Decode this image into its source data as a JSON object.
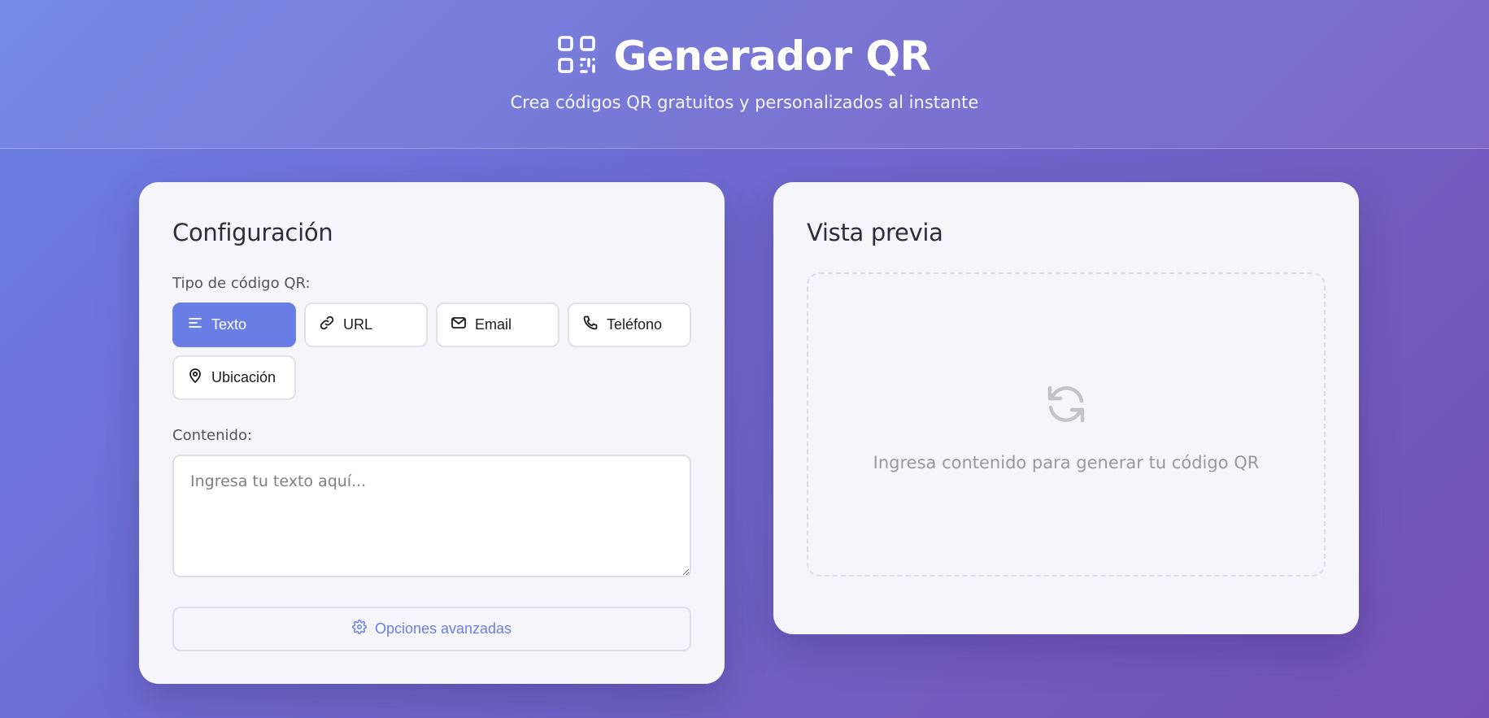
{
  "header": {
    "title": "Generador QR",
    "subtitle": "Crea códigos QR gratuitos y personalizados al instante",
    "logo_icon": "qr-code-icon"
  },
  "config": {
    "heading": "Configuración",
    "type_label": "Tipo de código QR:",
    "types": [
      {
        "label": "Texto",
        "icon": "text-lines-icon",
        "active": true
      },
      {
        "label": "URL",
        "icon": "link-icon",
        "active": false
      },
      {
        "label": "Email",
        "icon": "envelope-icon",
        "active": false
      },
      {
        "label": "Teléfono",
        "icon": "phone-icon",
        "active": false
      },
      {
        "label": "Ubicación",
        "icon": "map-pin-icon",
        "active": false
      }
    ],
    "content_label": "Contenido:",
    "content_placeholder": "Ingresa tu texto aquí...",
    "content_value": "",
    "advanced_label": "Opciones avanzadas",
    "advanced_icon": "gear-icon"
  },
  "preview": {
    "heading": "Vista previa",
    "empty_message": "Ingresa contenido para generar tu código QR",
    "empty_icon": "refresh-icon"
  },
  "colors": {
    "accent": "#6a7fe6",
    "background_start": "#6b80e4",
    "background_end": "#7450b4"
  }
}
